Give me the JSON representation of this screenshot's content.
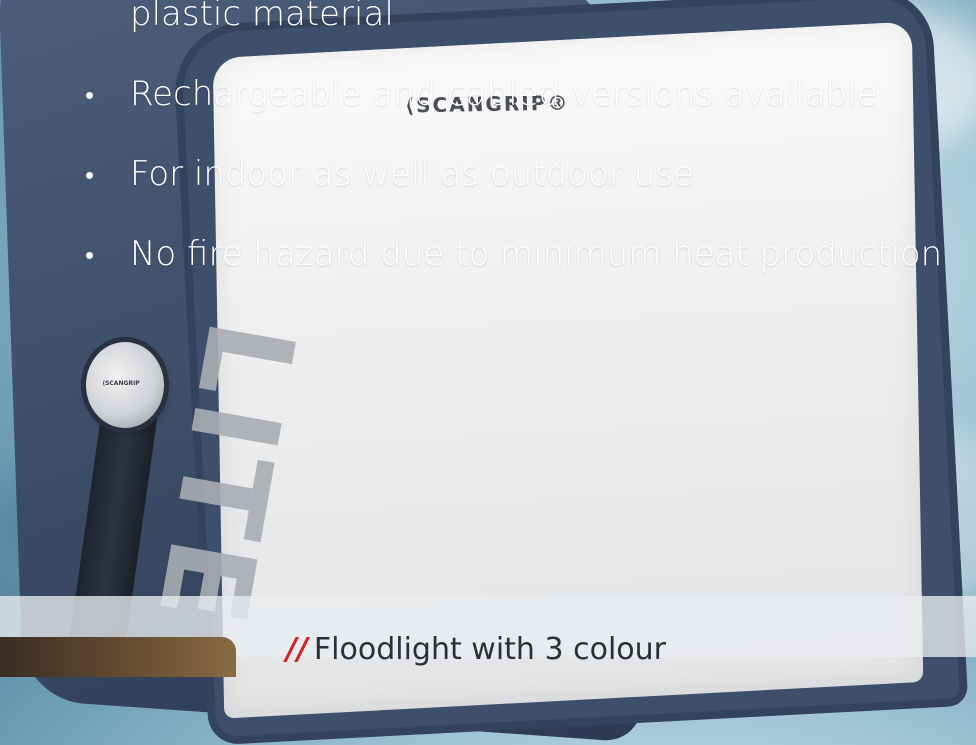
{
  "bullets": [
    {
      "text": "plastic material"
    },
    {
      "text": "Rechargeable and cabled versions available"
    },
    {
      "text": "For indoor as well as outdoor use"
    },
    {
      "text": "No fire hazard due to minimum heat production"
    }
  ],
  "product": {
    "brand": "⟨SCANGRIP®",
    "model": "LITE",
    "knob_brand": "⟨SCANGRIP"
  },
  "footer": {
    "prefix": "//",
    "headline": "Floodlight with 3 colour"
  },
  "colors": {
    "accent": "#d2232a",
    "frame": "#3e4f6c",
    "background": "#9fc4d3"
  }
}
